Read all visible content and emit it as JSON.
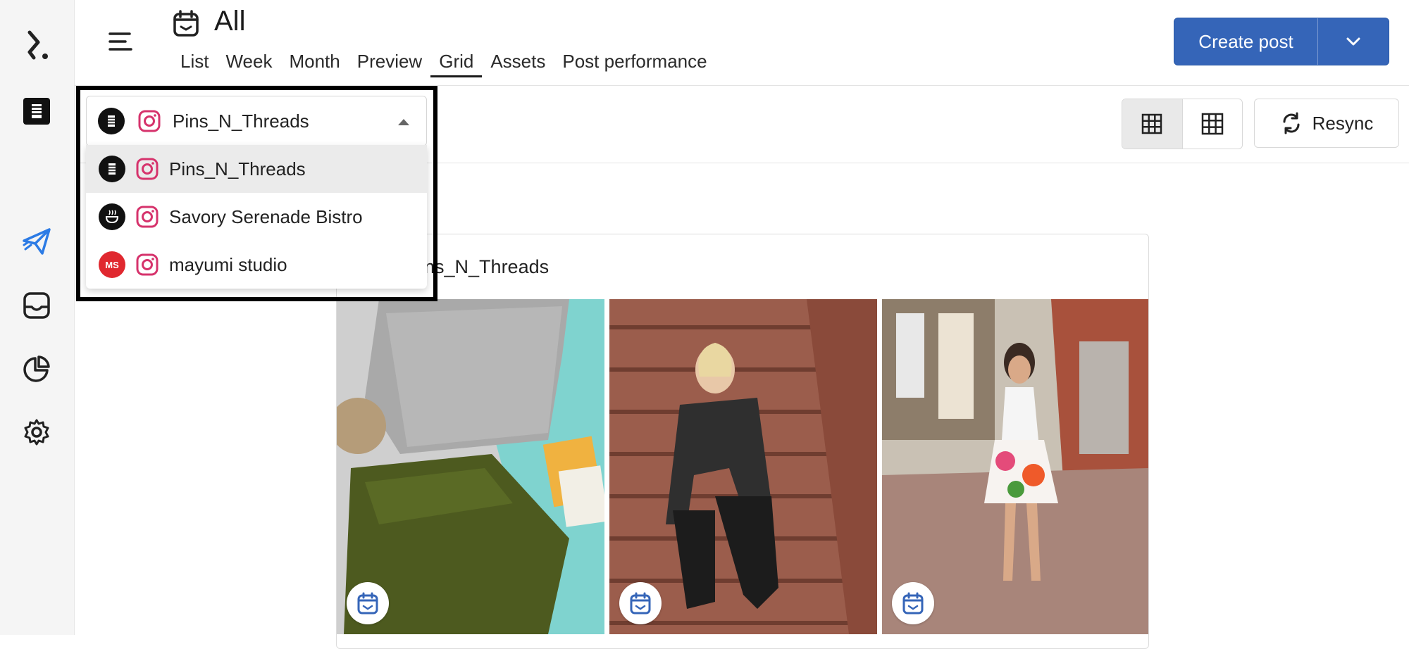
{
  "header": {
    "title": "All",
    "tabs": [
      {
        "label": "List"
      },
      {
        "label": "Week"
      },
      {
        "label": "Month"
      },
      {
        "label": "Preview"
      },
      {
        "label": "Grid",
        "active": true
      },
      {
        "label": "Assets"
      },
      {
        "label": "Post performance"
      }
    ],
    "create_post_label": "Create post"
  },
  "toolbar": {
    "resync_label": "Resync"
  },
  "account_selector": {
    "selected": "Pins_N_Threads",
    "options": [
      {
        "label": "Pins_N_Threads",
        "avatar_text": ""
      },
      {
        "label": "Savory Serenade Bistro",
        "avatar_text": ""
      },
      {
        "label": "mayumi studio",
        "avatar_text": "MS"
      }
    ]
  },
  "grid_card": {
    "account_name": "Pins_N_Threads"
  },
  "colors": {
    "primary": "#3565b8",
    "instagram": "#d6336c",
    "active_nav": "#2c7be5",
    "avatar_red": "#e0282f"
  },
  "icons": {
    "rail": [
      "logo-icon",
      "brand-avatar-icon",
      "paper-plane-icon",
      "inbox-icon",
      "pie-chart-icon",
      "gear-icon"
    ]
  }
}
